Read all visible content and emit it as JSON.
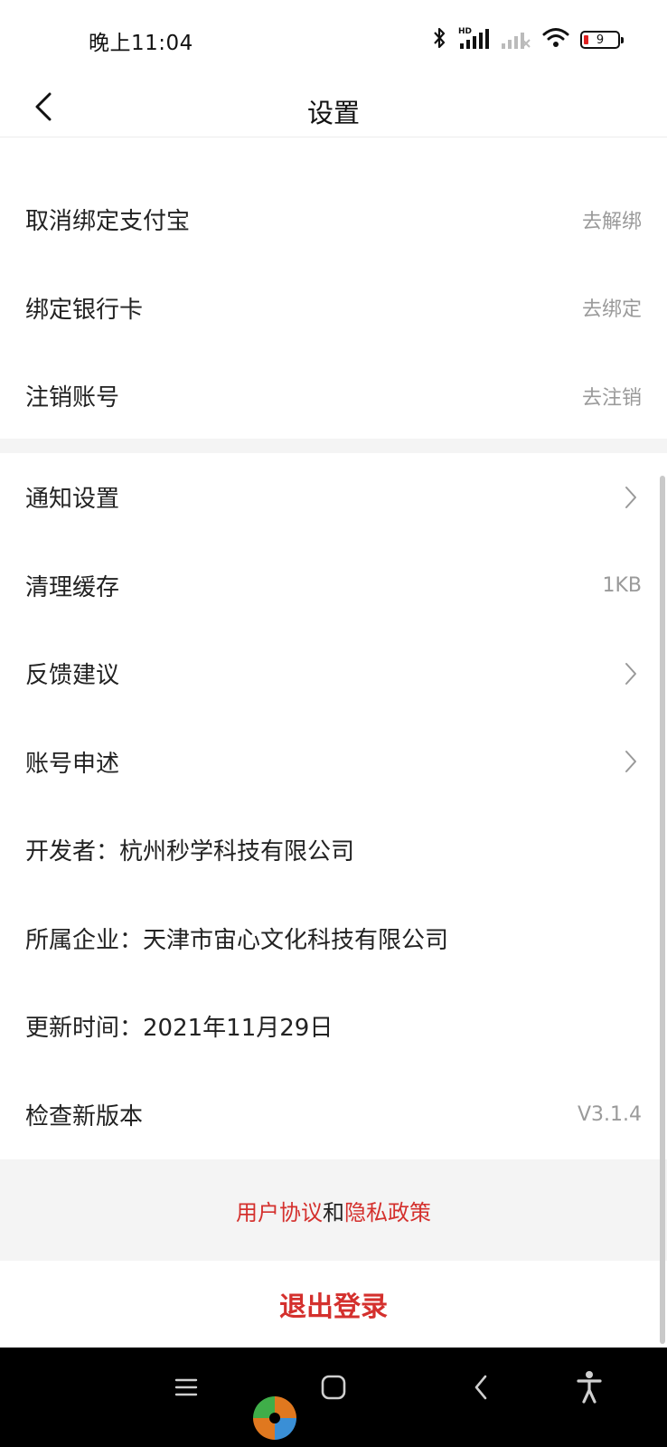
{
  "status_bar": {
    "time": "晚上11:04",
    "battery_level": "9",
    "icons": [
      "bluetooth-icon",
      "hd-signal-icon",
      "no-signal-icon",
      "wifi-icon",
      "battery-icon"
    ]
  },
  "nav": {
    "title": "设置",
    "back_icon": "chevron-left-icon"
  },
  "settings": {
    "group1": [
      {
        "label": "取消绑定支付宝",
        "value": "去解绑"
      },
      {
        "label": "绑定银行卡",
        "value": "去绑定"
      },
      {
        "label": "注销账号",
        "value": "去注销"
      }
    ],
    "group2": [
      {
        "label": "通知设置",
        "value": ""
      },
      {
        "label": "清理缓存",
        "value": "1KB"
      },
      {
        "label": "反馈建议",
        "value": ""
      },
      {
        "label": "账号申述",
        "value": ""
      },
      {
        "label": "开发者：杭州秒学科技有限公司",
        "value": ""
      },
      {
        "label": "所属企业：天津市宙心文化科技有限公司",
        "value": ""
      },
      {
        "label": "更新时间：2021年11月29日",
        "value": ""
      },
      {
        "label": "检查新版本",
        "value": "V3.1.4"
      }
    ]
  },
  "agreement": {
    "user_agreement": "用户协议",
    "joiner": "和",
    "privacy_policy": "隐私政策"
  },
  "logout_label": "退出登录",
  "colors": {
    "accent": "#d4302d",
    "background_band": "#f4f4f4",
    "secondary_text": "#9a9a9a"
  },
  "system_nav_icons": [
    "menu-icon",
    "home-icon",
    "back-icon",
    "accessibility-icon"
  ]
}
